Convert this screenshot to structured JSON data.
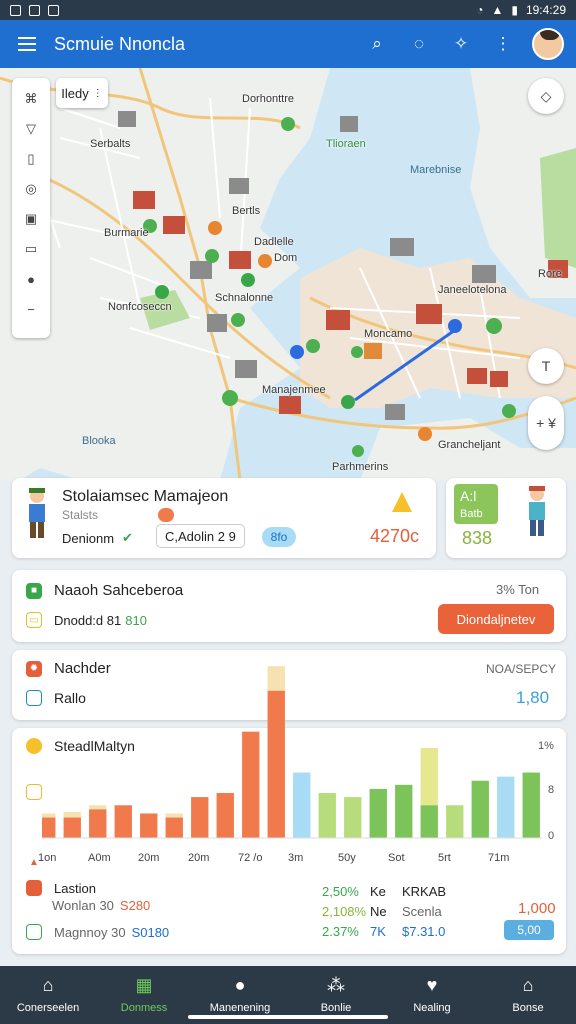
{
  "status": {
    "time": "19:4:29"
  },
  "appbar": {
    "title": "Scmuie Nnoncla",
    "icons": [
      "search-icon",
      "chat-icon",
      "badge-icon",
      "more-icon"
    ]
  },
  "map": {
    "chip_label": "Iledy",
    "labels": {
      "l1": "Dorhonttre",
      "l2": "Serbalts",
      "l3": "Tlioraen",
      "l4": "Bertls",
      "l5": "Burmarie",
      "l6": "Dadlelle",
      "l7": "Dom",
      "l8": "Nonfcoseccn",
      "l9": "Schnalonne",
      "l10": "Marebnise",
      "l11": "Janeelotelona",
      "l12": "Moncamo",
      "l13": "Manajenmee",
      "l14": "Blooka",
      "l15": "Parhmerins",
      "l16": "Grancheljant",
      "l17": "Rore"
    },
    "fab_top": "◇",
    "fab_mid": "T",
    "fab_low": "+ ¥"
  },
  "card1": {
    "title": "Stolaiamsec Mamajeon",
    "subtitle": "Stalsts",
    "left_chip": "Denionm",
    "mid": "C,Adolin 2 9",
    "badge": "8fo",
    "value": "4270c"
  },
  "card1b": {
    "top": "A:l",
    "mid": "Batb",
    "value": "838"
  },
  "card2": {
    "title": "Naaoh Sahceberoa",
    "right_text": "3% Ton",
    "sub": "Dnodd:d 81",
    "sub_value": "810",
    "button": "Diondaljnetev"
  },
  "card3": {
    "title": "Nachder",
    "right_text": "NOA/SEPCY",
    "sub": "Rallo",
    "value": "1,80"
  },
  "chart": {
    "title": "SteadlMaltyn",
    "y_top": "1%",
    "y_mid": "8",
    "y_zero": "0",
    "x_labels": [
      "1on",
      "A0m",
      "20m",
      "20m",
      "72 /o",
      "3m",
      "50y",
      "Sot",
      "5rt",
      "71m"
    ],
    "legend": [
      {
        "name": "Lastion",
        "label": "",
        "value": ""
      },
      {
        "name": "Wonlan 30",
        "label": "",
        "value": "S280"
      },
      {
        "name": "Magnnoy 30",
        "label": "",
        "value": "S0180"
      }
    ],
    "stats_mid": [
      {
        "a": "2,50%",
        "b": "Ke",
        "c": "KRKAB"
      },
      {
        "a": "2,108%",
        "b": "Ne",
        "c": "Scenla"
      },
      {
        "a": "2.37%",
        "b": "7K",
        "c": "$7.31.0"
      }
    ],
    "right_value": "1,000",
    "right_badge": "5,00"
  },
  "chart_data": {
    "type": "bar",
    "categories": [
      "1on",
      "A0m",
      "20m",
      "20m",
      "72 /o",
      "3m",
      "50y",
      "Sot",
      "5rt",
      "71m"
    ],
    "series": [
      {
        "name": "",
        "values": [
          2.5,
          2.5,
          3.5,
          4.0,
          3.0,
          2.5,
          5.0,
          5.5,
          13.0,
          18.0,
          8.0,
          5.5,
          5.0,
          6.0,
          6.5,
          4.0,
          4.0,
          7.0,
          7.5,
          8.0
        ]
      },
      {
        "name": "",
        "values": [
          3.0,
          3.2,
          4.0,
          4.0,
          3.0,
          3.0,
          5.0,
          5.5,
          13.0,
          21.0,
          8.0,
          5.5,
          5.0,
          6.0,
          6.5,
          11.0,
          4.0,
          7.0,
          7.5,
          8.0
        ]
      }
    ],
    "colors": [
      "#f07a4b",
      "#f6e1b0",
      "#a8dcf4",
      "#b7dc7c",
      "#7cc45a",
      "#e5e88f"
    ],
    "ylim": [
      0,
      22
    ]
  },
  "nav": [
    {
      "label": "Conerseelen",
      "icon": "home-icon"
    },
    {
      "label": "Donmess",
      "icon": "building-icon"
    },
    {
      "label": "Manenening",
      "icon": "user-icon"
    },
    {
      "label": "Bonlie",
      "icon": "group-icon"
    },
    {
      "label": "Nealing",
      "icon": "cup-icon"
    },
    {
      "label": "Bonse",
      "icon": "house-icon"
    }
  ]
}
